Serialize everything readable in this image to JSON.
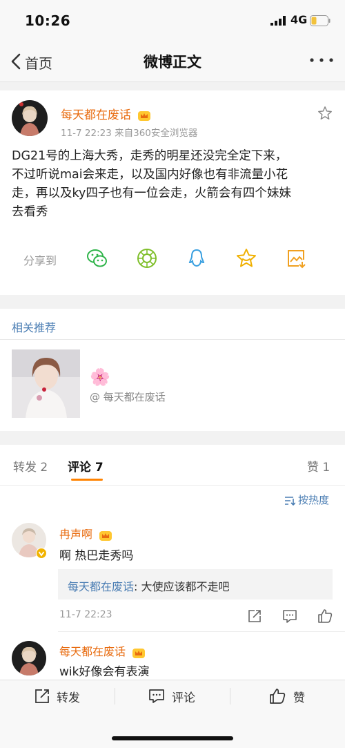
{
  "status": {
    "time": "10:26",
    "network": "4G"
  },
  "nav": {
    "back_label": "首页",
    "title": "微博正文"
  },
  "post": {
    "author": "每天都在废话",
    "meta": "11-7 22:23  来自360安全浏览器",
    "text": "DG21号的上海大秀，走秀的明星还没完全定下来，\n不过听说mai会来走，以及国内好像也有非流量小花\n走，再以及ky四子也有一位会走，火箭会有四个妹妹\n去看秀",
    "share_label": "分享到"
  },
  "related": {
    "title": "相关推荐",
    "emoji": "🌸",
    "user": "@ 每天都在废话"
  },
  "tabs": {
    "repost": "转发 2",
    "comment": "评论 7",
    "like": "赞 1",
    "sort": "按热度"
  },
  "comments": [
    {
      "author": "冉声啊",
      "text": "啊 热巴走秀吗",
      "reply_author": "每天都在废话",
      "reply_text": ": 大使应该都不走吧",
      "time": "11-7 22:23"
    },
    {
      "author": "每天都在废话",
      "text": "wik好像会有表演"
    }
  ],
  "bottom": {
    "repost": "转发",
    "comment": "评论",
    "like": "赞"
  },
  "colors": {
    "accent": "#e86b0f",
    "link": "#4a7db3",
    "tab_underline": "#ff8200"
  }
}
